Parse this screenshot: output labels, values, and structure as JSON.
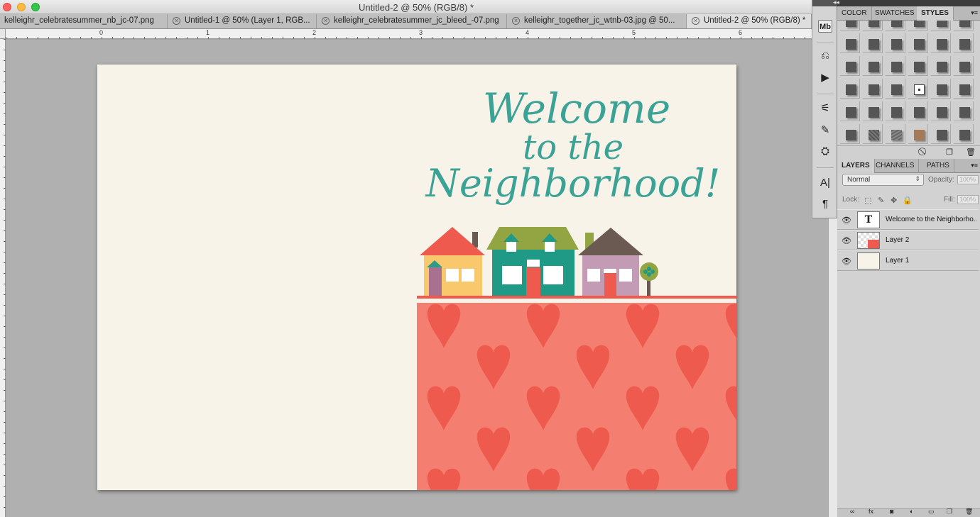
{
  "window": {
    "title": "Untitled-2 @ 50% (RGB/8) *"
  },
  "tabs": [
    {
      "label": "kelleighr_celebratesummer_nb_jc-07.png",
      "active": false
    },
    {
      "label": "Untitled-1 @ 50% (Layer 1, RGB...",
      "active": false
    },
    {
      "label": "kelleighr_celebratesummer_jc_bleed_-07.png",
      "active": false
    },
    {
      "label": "kelleighr_together_jc_wtnb-03.jpg @ 50...",
      "active": false
    },
    {
      "label": "Untitled-2 @ 50% (RGB/8) *",
      "active": true
    }
  ],
  "ruler": {
    "marks": [
      "0",
      "1",
      "2",
      "3",
      "4",
      "5",
      "6"
    ]
  },
  "canvas": {
    "welcome_lines": [
      "Welcome",
      "to the",
      "Neighborhood!"
    ],
    "text_color": "#3ba296",
    "paper_color": "#f7f3e8",
    "heart_bg_color": "#f47f71",
    "heart_color": "#ee5b4e"
  },
  "toolstrip": {
    "icons": [
      "mini-bridge-icon",
      "history-icon",
      "actions-icon",
      "tool-presets-icon",
      "brush-icon",
      "clone-source-icon",
      "character-icon",
      "paragraph-icon"
    ],
    "mb_label": "Mb"
  },
  "styles_panel": {
    "tabs": [
      {
        "label": "COLOR",
        "active": false
      },
      {
        "label": "SWATCHES",
        "active": false
      },
      {
        "label": "STYLES",
        "active": true
      }
    ]
  },
  "layers_panel": {
    "tabs": [
      {
        "label": "LAYERS",
        "active": true
      },
      {
        "label": "CHANNELS",
        "active": false
      },
      {
        "label": "PATHS",
        "active": false
      }
    ],
    "blend_mode": "Normal",
    "opacity_label": "Opacity:",
    "opacity_value": "100%",
    "lock_label": "Lock:",
    "fill_label": "Fill:",
    "fill_value": "100%",
    "layers": [
      {
        "name": "Welcome to the  Neighborho...",
        "kind": "text",
        "thumb_glyph": "T"
      },
      {
        "name": "Layer 2",
        "kind": "image",
        "thumb_glyph": ""
      },
      {
        "name": "Layer 1",
        "kind": "fill",
        "thumb_glyph": ""
      }
    ]
  }
}
